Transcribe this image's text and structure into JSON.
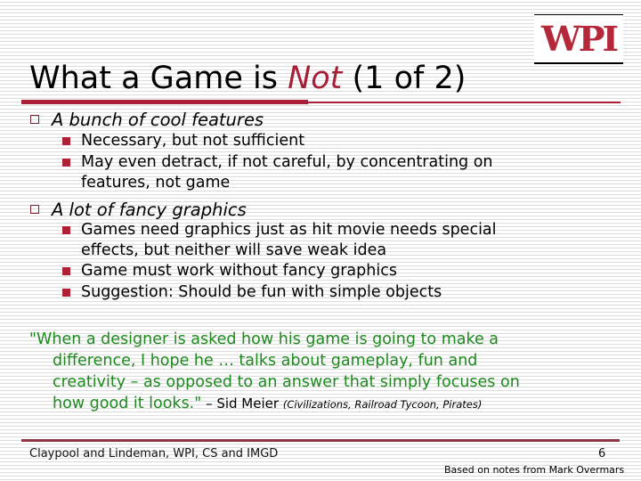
{
  "logo": {
    "text": "WPI",
    "color": "#b5283a"
  },
  "title": {
    "prefix": "What a Game is ",
    "emphasis": "Not",
    "suffix": " (1 of 2)",
    "accent_color": "#a51f36"
  },
  "bullets": [
    {
      "text": "A bunch of cool features",
      "icon": "hollow-square-bullet",
      "sub": [
        {
          "lines": [
            "Necessary, but not sufficient"
          ]
        },
        {
          "lines": [
            "May even detract, if not careful, by concentrating on",
            "features, not game"
          ]
        }
      ]
    },
    {
      "text": "A lot of fancy graphics",
      "icon": "hollow-square-bullet",
      "sub": [
        {
          "lines": [
            "Games need graphics just as hit movie needs special",
            "effects, but neither will save weak idea"
          ]
        },
        {
          "lines": [
            "Game must work without fancy graphics"
          ]
        },
        {
          "lines": [
            "Suggestion: Should be fun with simple objects"
          ]
        }
      ]
    }
  ],
  "quote": {
    "lines": [
      "\"When a designer is asked how his game is going to make a",
      "difference, I hope he … talks about gameplay, fun and",
      "creativity – as opposed to an answer that simply focuses on",
      "how good it looks.\""
    ],
    "attribution": " – Sid Meier ",
    "works": "(Civilizations, Railroad Tycoon, Pirates)",
    "color": "#1e8a1e"
  },
  "footer": {
    "left": "Claypool and Lindeman, WPI, CS and IMGD",
    "page_number": "6",
    "note": "Based on notes from Mark Overmars"
  }
}
